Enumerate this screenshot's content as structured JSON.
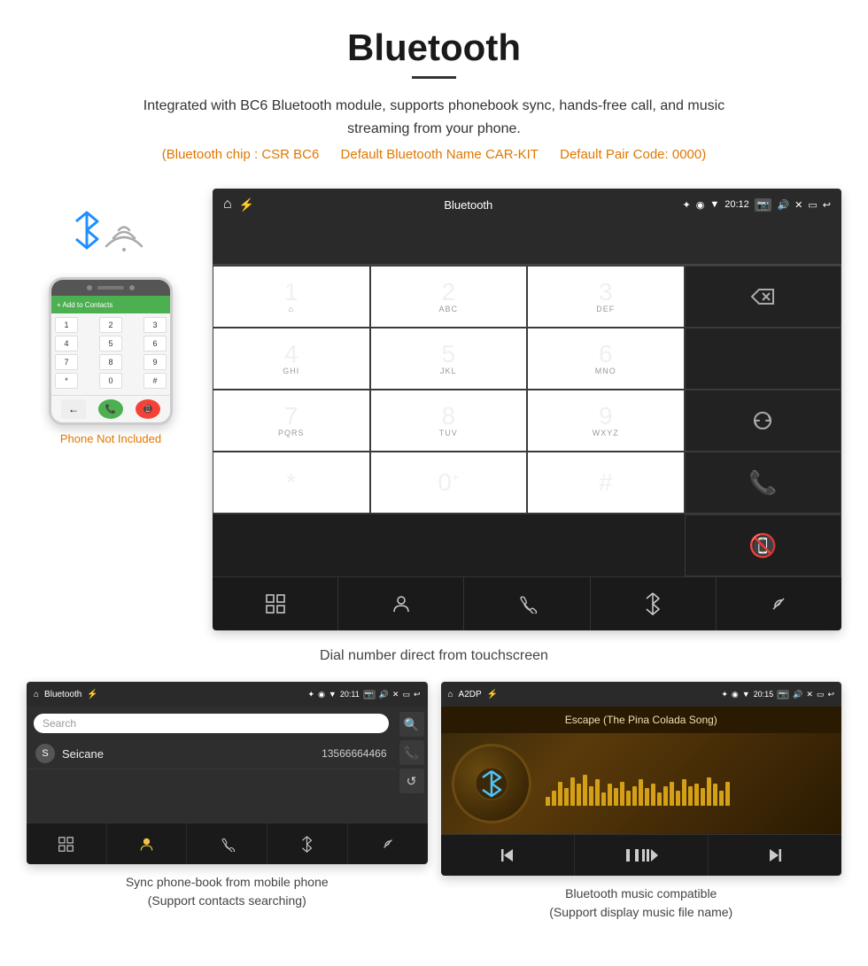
{
  "page": {
    "title": "Bluetooth",
    "underline": true,
    "description": "Integrated with BC6 Bluetooth module, supports phonebook sync, hands-free call, and music streaming from your phone.",
    "specs": {
      "chip": "(Bluetooth chip : CSR BC6",
      "name": "Default Bluetooth Name CAR-KIT",
      "pair_code": "Default Pair Code: 0000)"
    }
  },
  "phone_illustration": {
    "not_included": "Phone Not Included",
    "add_to_contacts": "Add to Contacts"
  },
  "car_screen": {
    "statusbar": {
      "app_name": "Bluetooth",
      "time": "20:12"
    },
    "dialpad": {
      "keys": [
        {
          "num": "1",
          "sub": "⌂"
        },
        {
          "num": "2",
          "sub": "ABC"
        },
        {
          "num": "3",
          "sub": "DEF"
        },
        {
          "num": "",
          "sub": "",
          "type": "backspace"
        },
        {
          "num": "4",
          "sub": "GHI"
        },
        {
          "num": "5",
          "sub": "JKL"
        },
        {
          "num": "6",
          "sub": "MNO"
        },
        {
          "num": "",
          "sub": "",
          "type": "empty"
        },
        {
          "num": "7",
          "sub": "PQRS"
        },
        {
          "num": "8",
          "sub": "TUV"
        },
        {
          "num": "9",
          "sub": "WXYZ"
        },
        {
          "num": "",
          "sub": "",
          "type": "refresh"
        },
        {
          "num": "*",
          "sub": ""
        },
        {
          "num": "0",
          "sub": "+"
        },
        {
          "num": "#",
          "sub": ""
        },
        {
          "num": "",
          "sub": "",
          "type": "call-green"
        },
        {
          "num": "",
          "sub": "",
          "type": "call-red"
        }
      ]
    },
    "bottom_bar": [
      "grid",
      "person",
      "phone",
      "bluetooth",
      "link"
    ]
  },
  "dial_caption": "Dial number direct from touchscreen",
  "contacts_screen": {
    "statusbar": {
      "app_name": "Bluetooth",
      "time": "20:11"
    },
    "search_placeholder": "Search",
    "contacts": [
      {
        "letter": "S",
        "name": "Seicane",
        "number": "13566664466"
      }
    ],
    "bottom_bar": [
      "grid",
      "person",
      "phone",
      "bluetooth",
      "link"
    ]
  },
  "contacts_caption": {
    "line1": "Sync phone-book from mobile phone",
    "line2": "(Support contacts searching)"
  },
  "music_screen": {
    "statusbar": {
      "app_name": "A2DP",
      "time": "20:15"
    },
    "song_title": "Escape (The Pina Colada Song)",
    "eq_bars": [
      20,
      35,
      55,
      40,
      65,
      50,
      70,
      45,
      60,
      30,
      50,
      40,
      55,
      35,
      45,
      60,
      40,
      50,
      30,
      45,
      55,
      35,
      60,
      45,
      50,
      40,
      65,
      50,
      35,
      55
    ],
    "controls": [
      "prev",
      "play",
      "next"
    ]
  },
  "music_caption": {
    "line1": "Bluetooth music compatible",
    "line2": "(Support display music file name)"
  }
}
